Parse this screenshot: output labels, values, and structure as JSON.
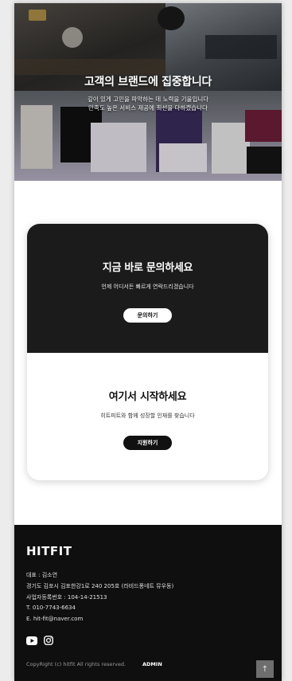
{
  "hero": {
    "title": "고객의 브랜드에 집중합니다",
    "subtitle_line1": "깊이 있게 고민을 파악하는 데 노력을 기울입니다",
    "subtitle_line2": "만족도 높은 서비스 제공에 최선을 다하겠습니다"
  },
  "contact_card": {
    "title": "지금 바로 문의하세요",
    "description": "언제 어디서든 빠르게 연락드리겠습니다",
    "button_label": "문의하기"
  },
  "recruit_card": {
    "title": "여기서 시작하세요",
    "description": "히트피트와 함께 성장할 인재를 찾습니다",
    "button_label": "지원하기"
  },
  "footer": {
    "logo": "HITFIT",
    "ceo": "대표 : 김소연",
    "address": "경기도 김포시 김포한강1로 240 205호 (라비드퐁네트 뮤우동)",
    "business_number": "사업자등록번호 : 104-14-21513",
    "phone": "T.  010-7743-6634",
    "email": "E.  hit-fit@naver.com",
    "social": [
      "youtube-icon",
      "instagram-icon"
    ],
    "copyright": "CopyRight (c) hitfit All rights reserved.",
    "admin_label": "ADMIN",
    "top_button_icon": "arrow-up-icon"
  },
  "colors": {
    "dark_card": "#1b1b1b",
    "footer_bg": "#0f0f0f",
    "accent_white": "#ffffff"
  }
}
